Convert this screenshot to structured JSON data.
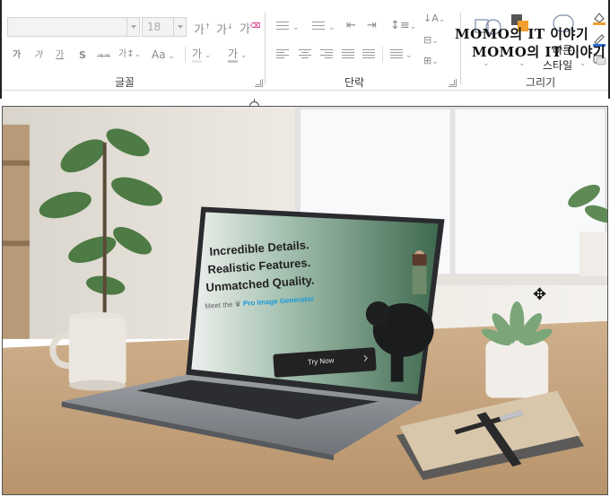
{
  "ribbon": {
    "font_group": {
      "font_name": "",
      "font_size": "18",
      "grow_font": "가",
      "shrink_font": "가",
      "clear_format": "가",
      "bold": "가",
      "italic": "가",
      "underline": "가",
      "shadow": "S",
      "strike": "ㅋㅋ",
      "spacing": "가↕",
      "change_case": "Aa",
      "highlight": "가",
      "font_color": "가",
      "label": "글꼴"
    },
    "paragraph_group": {
      "label": "단락"
    },
    "drawing_group": {
      "label": "그리기",
      "quick_styles": "빠른\n스타일"
    },
    "overlay": {
      "line1": "MOMO의 IT 이야기",
      "line2": "MOMO의 IT 이야기",
      "small1": "빠른",
      "small2": "스타일"
    }
  },
  "image": {
    "screen_lines": [
      "Incredible Details.",
      "Realistic Features.",
      "Unmatched Quality."
    ],
    "meet_prefix": "Meet the",
    "product": "Pro Image Generator",
    "cta": "Try Now"
  },
  "colors": {
    "accent": "#1a9bd7",
    "orange": "#f0a030",
    "blue": "#2f6fd6"
  }
}
